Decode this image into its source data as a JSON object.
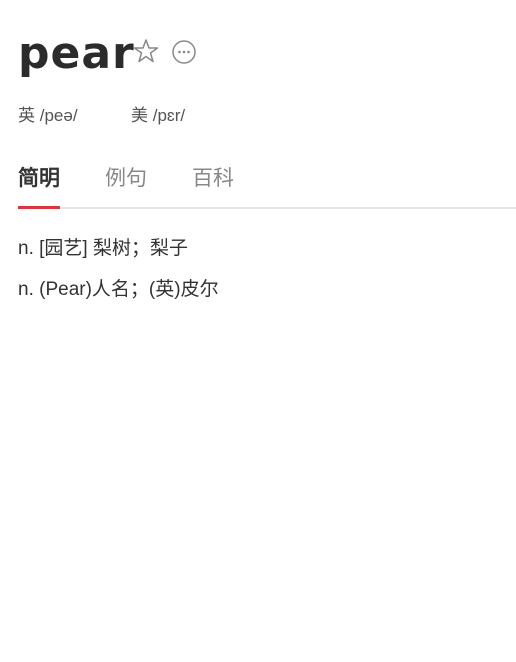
{
  "word": "pear",
  "pronunciations": [
    {
      "label": "英",
      "ipa": "/peə/"
    },
    {
      "label": "美",
      "ipa": "/pɛr/"
    }
  ],
  "tabs": [
    {
      "label": "简明"
    },
    {
      "label": "例句"
    },
    {
      "label": "百科"
    }
  ],
  "definitions": [
    "n. [园艺] 梨树；梨子",
    "n. (Pear)人名；(英)皮尔"
  ],
  "accent": "#d9363e"
}
